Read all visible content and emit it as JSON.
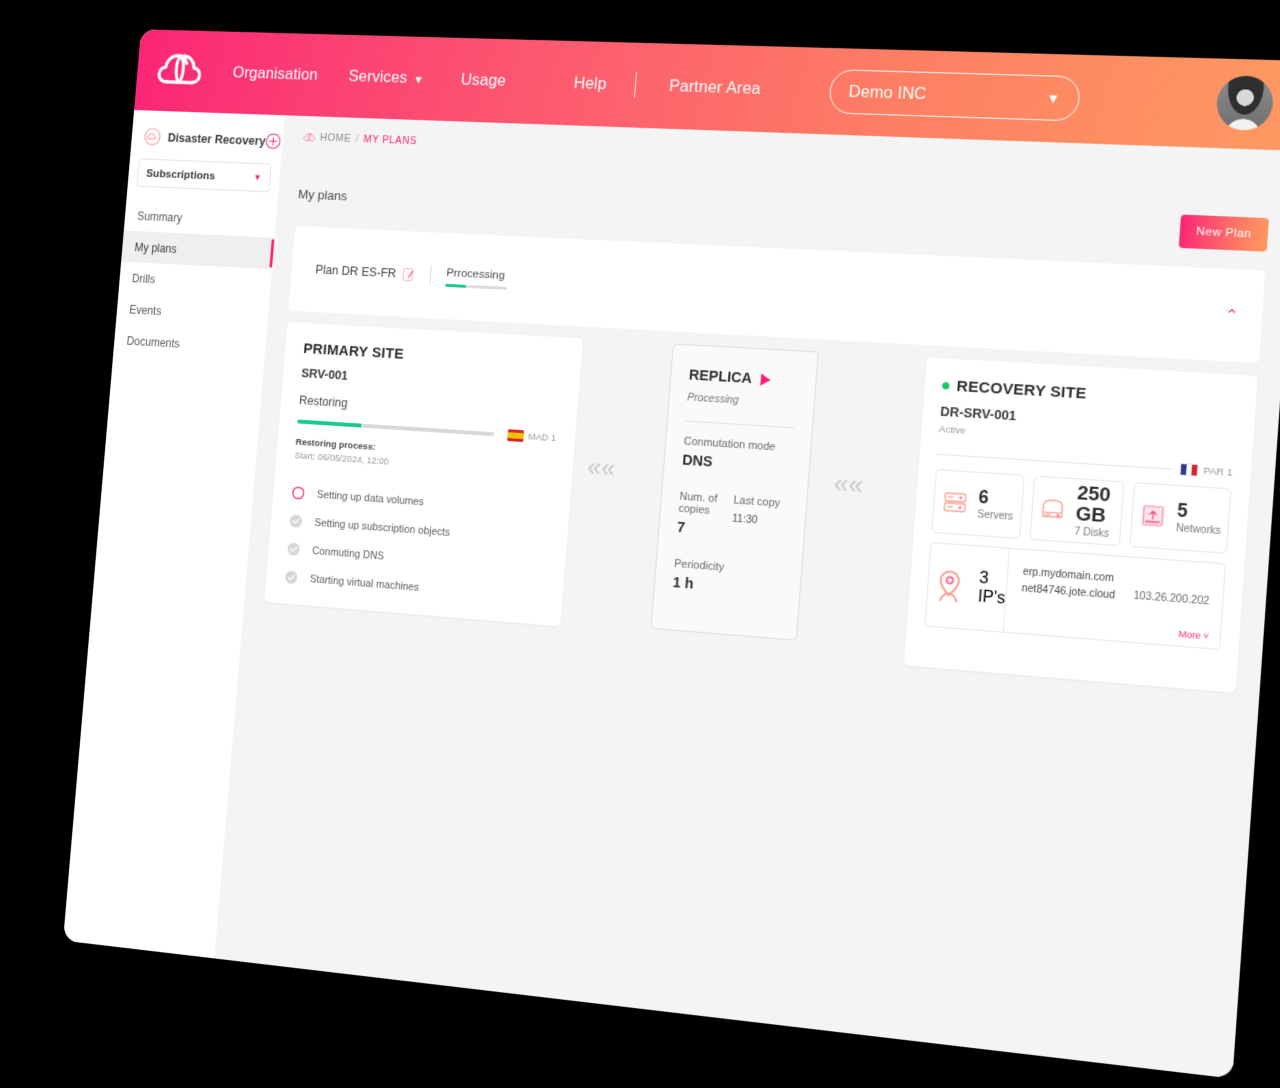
{
  "header": {
    "logo_icon": "cloud-logo",
    "nav": [
      {
        "label": "Organisation",
        "has_caret": false
      },
      {
        "label": "Services",
        "has_caret": true
      },
      {
        "label": "Usage",
        "has_caret": false
      },
      {
        "label": "Help",
        "has_caret": false
      },
      {
        "label": "Partner Area",
        "has_caret": false
      }
    ],
    "org_selector": {
      "value": "Demo INC",
      "caret_icon": "chevron-down-icon"
    },
    "avatar_icon": "user-avatar"
  },
  "sidebar": {
    "service": {
      "label": "Disaster Recovery",
      "icon": "cloud-outline-icon",
      "add_icon": "plus-circle-icon"
    },
    "subscriptions": {
      "label": "Subscriptions",
      "caret_icon": "chevron-down-icon"
    },
    "items": [
      {
        "label": "Summary",
        "active": false
      },
      {
        "label": "My plans",
        "active": true
      },
      {
        "label": "Drills",
        "active": false
      },
      {
        "label": "Events",
        "active": false
      },
      {
        "label": "Documents",
        "active": false
      }
    ]
  },
  "breadcrumb": {
    "icon": "cloud-icon",
    "home": "HOME",
    "separator": "/",
    "current": "MY PLANS"
  },
  "page": {
    "title": "My plans",
    "new_plan_button": "New  Plan"
  },
  "plan_panel": {
    "name": "Plan DR ES-FR",
    "edit_icon": "edit-document-icon",
    "status": "Prrocessing",
    "status_progress_pct": 33,
    "collapse_icon": "chevron-up-icon"
  },
  "primary_site": {
    "title": "PRIMARY SITE",
    "server": "SRV-001",
    "state": "Restoring",
    "progress_pct": 33,
    "region": {
      "flag": "es",
      "label": "MAD 1"
    },
    "process_label": "Restoring process:",
    "start": "Start: 06/05/2024, 12:00",
    "steps": [
      {
        "label": "Setting up data volumes",
        "status": "in-progress"
      },
      {
        "label": "Setting up subscription objects",
        "status": "done"
      },
      {
        "label": "Conmuting DNS",
        "status": "done"
      },
      {
        "label": "Starting virtual machines",
        "status": "done"
      }
    ]
  },
  "replica": {
    "title": "REPLICA",
    "play_icon": "play-icon",
    "state": "Processing",
    "commutation_label": "Conmutation mode",
    "commutation_value": "DNS",
    "copies_label": "Num. of copies",
    "copies_value": "7",
    "last_copy_label": "Last copy",
    "last_copy_value": "11:30",
    "periodicity_label": "Periodicity",
    "periodicity_value": "1 h"
  },
  "recovery_site": {
    "title": "RECOVERY SITE",
    "status_dot_color": "#17c964",
    "server": "DR-SRV-001",
    "state": "Active",
    "region": {
      "flag": "fr",
      "label": "PAR 1"
    },
    "stats": [
      {
        "icon": "server-rack-icon",
        "value": "6",
        "caption": "Servers"
      },
      {
        "icon": "disk-icon",
        "value": "250 GB",
        "caption": "7 Disks"
      },
      {
        "icon": "network-icon",
        "value": "5",
        "caption": "Networks"
      }
    ],
    "ips": {
      "icon": "location-pin-icon",
      "value": "3",
      "caption": "IP's",
      "domains": [
        "erp.mydomain.com",
        "net84746.jote.cloud"
      ],
      "address": "103.26.200.202",
      "more_label": "More ˅"
    }
  },
  "arrows": {
    "glyph": "««"
  },
  "colors": {
    "brand_pink": "#fb2576",
    "brand_orange": "#fe9a62",
    "green": "#16c98d",
    "active_green": "#17c964"
  }
}
